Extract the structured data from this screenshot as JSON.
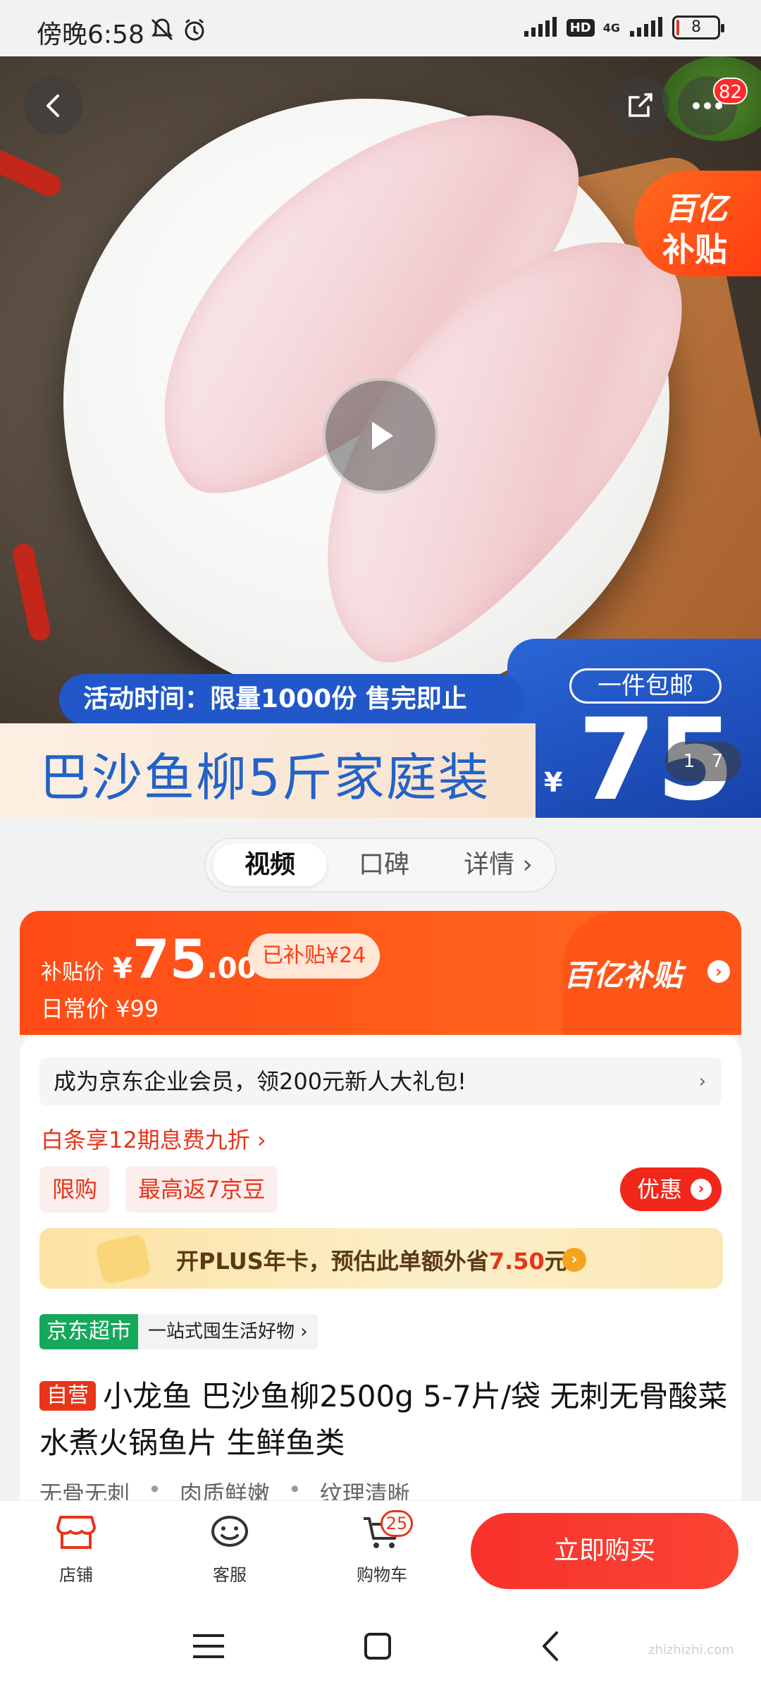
{
  "status_bar": {
    "time": "傍晚6:58",
    "hd": "HD",
    "network": "4G",
    "battery": "8",
    "battery_level": 0.08
  },
  "hero": {
    "share_count_badge": "82",
    "subsidy_tag_line1": "百亿",
    "subsidy_tag_line2": "补贴",
    "activity_time": "活动时间：限量1000份 售完即止",
    "banner_title": "巴沙鱼柳5斤家庭装",
    "free_shipping": "一件包邮",
    "banner_currency": "¥",
    "banner_price": "75",
    "pager_current": "1",
    "pager_total": "7"
  },
  "tabs": [
    {
      "label": "视频",
      "active": true
    },
    {
      "label": "口碑",
      "active": false
    },
    {
      "label": "详情 ›",
      "active": false
    }
  ],
  "price": {
    "label": "补贴价",
    "currency": "¥",
    "integer": "75",
    "decimal": ".00",
    "subsidy_badge": "已补贴¥24",
    "daily_price": "日常价 ¥99",
    "brand": "百亿补贴",
    "brand_arrow": "›"
  },
  "promo": {
    "member_banner": "成为京东企业会员，领200元新人大礼包!",
    "member_arrow": "›",
    "baitiao": "白条享12期息费九折 ›",
    "chips": [
      "限购",
      "最高返7京豆"
    ],
    "youhui_label": "优惠",
    "youhui_arrow": "›",
    "plus_text_prefix": "开PLUS年卡，预估此单额外省",
    "plus_amount": "7.50",
    "plus_text_suffix": "元",
    "plus_arrow": "›"
  },
  "store_tag": {
    "label": "京东超市",
    "desc": "一站式囤生活好物 ›"
  },
  "product": {
    "self_operated": "自营",
    "title": "小龙鱼 巴沙鱼柳2500g  5-7片/袋 无刺无骨酸菜水煮火锅鱼片 生鲜鱼类",
    "features": [
      "无骨无刺",
      "肉质鲜嫩",
      "纹理清晰"
    ],
    "feature_separator": "•"
  },
  "bottom_bar": {
    "store_label": "店铺",
    "service_label": "客服",
    "cart_label": "购物车",
    "cart_count": "25",
    "buy_button": "立即购买"
  },
  "watermark": "zhizhizhi.com",
  "colors": {
    "accent": "#ff5518",
    "buy": "#f7322b",
    "jd_market": "#16a85a",
    "banner_blue": "#2157c8"
  }
}
